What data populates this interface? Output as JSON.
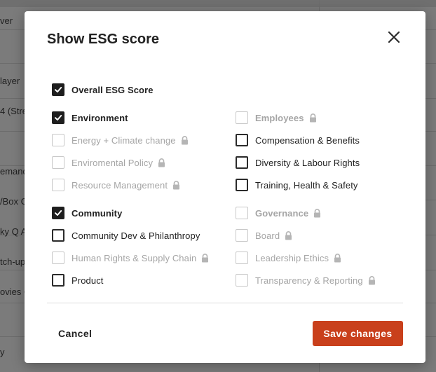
{
  "background": {
    "rows": [
      "ver",
      "layer",
      "4 (Stre",
      "emand",
      "/Box C",
      "ky Q A",
      "tch-up",
      "ovies C",
      "y"
    ]
  },
  "dialog": {
    "title": "Show ESG score",
    "overall": {
      "label": "Overall ESG Score",
      "checked": true,
      "locked": false,
      "disabled": false
    },
    "left_column": [
      {
        "label": "Environment",
        "checked": true,
        "locked": false,
        "disabled": false,
        "header": true
      },
      {
        "label": "Energy + Climate change",
        "checked": false,
        "locked": true,
        "disabled": true,
        "header": false
      },
      {
        "label": "Enviromental Policy",
        "checked": false,
        "locked": true,
        "disabled": true,
        "header": false
      },
      {
        "label": "Resource Management",
        "checked": false,
        "locked": true,
        "disabled": true,
        "header": false
      },
      {
        "label": "Community",
        "checked": true,
        "locked": false,
        "disabled": false,
        "header": true
      },
      {
        "label": "Community Dev & Philanthropy",
        "checked": false,
        "locked": false,
        "disabled": false,
        "header": false
      },
      {
        "label": "Human Rights & Supply Chain",
        "checked": false,
        "locked": true,
        "disabled": true,
        "header": false
      },
      {
        "label": "Product",
        "checked": false,
        "locked": false,
        "disabled": false,
        "header": false
      }
    ],
    "right_column": [
      {
        "label": "Employees",
        "checked": false,
        "locked": true,
        "disabled": true,
        "header": true
      },
      {
        "label": "Compensation & Benefits",
        "checked": false,
        "locked": false,
        "disabled": false,
        "header": false
      },
      {
        "label": "Diversity & Labour Rights",
        "checked": false,
        "locked": false,
        "disabled": false,
        "header": false
      },
      {
        "label": "Training, Health & Safety",
        "checked": false,
        "locked": false,
        "disabled": false,
        "header": false
      },
      {
        "label": "Governance",
        "checked": false,
        "locked": true,
        "disabled": true,
        "header": true
      },
      {
        "label": "Board",
        "checked": false,
        "locked": true,
        "disabled": true,
        "header": false
      },
      {
        "label": "Leadership Ethics",
        "checked": false,
        "locked": true,
        "disabled": true,
        "header": false
      },
      {
        "label": "Transparency & Reporting",
        "checked": false,
        "locked": true,
        "disabled": true,
        "header": false
      }
    ],
    "cancel_label": "Cancel",
    "save_label": "Save changes"
  },
  "icons": {
    "close": "close-icon",
    "lock": "lock-icon",
    "check": "checkmark-icon"
  },
  "colors": {
    "accent": "#c9401c",
    "checkbox": "#1e1e1e",
    "disabled_text": "#a5a5a5",
    "overlay": "#7b7b7b"
  }
}
